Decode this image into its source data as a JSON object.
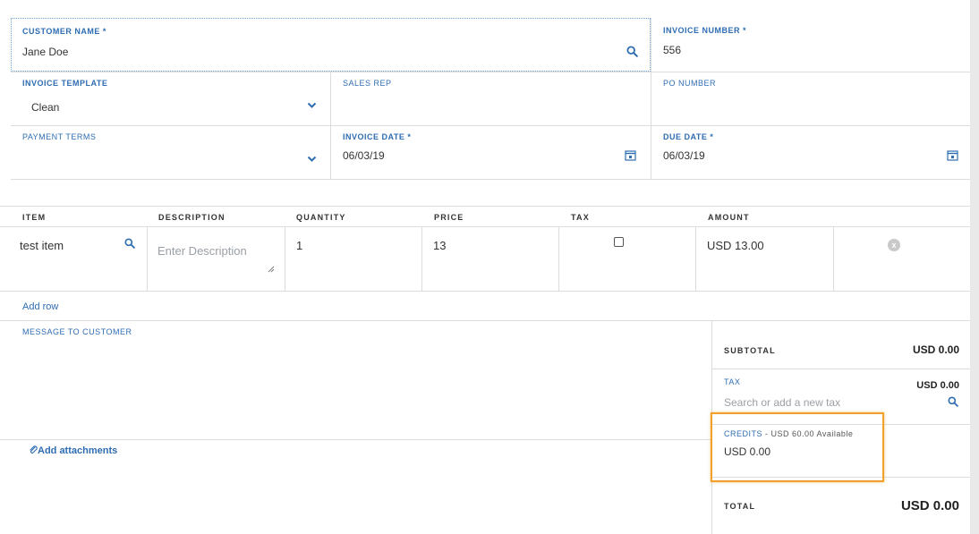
{
  "header": {
    "customer_name_label": "CUSTOMER NAME *",
    "customer_name_value": "Jane Doe",
    "invoice_number_label": "INVOICE NUMBER *",
    "invoice_number_value": "556"
  },
  "fields": {
    "invoice_template_label": "INVOICE TEMPLATE",
    "invoice_template_value": "Clean",
    "sales_rep_label": "SALES REP",
    "po_number_label": "PO NUMBER",
    "payment_terms_label": "PAYMENT TERMS",
    "invoice_date_label": "INVOICE DATE *",
    "invoice_date_value": "06/03/19",
    "due_date_label": "DUE DATE *",
    "due_date_value": "06/03/19"
  },
  "table": {
    "columns": [
      "ITEM",
      "DESCRIPTION",
      "QUANTITY",
      "PRICE",
      "TAX",
      "AMOUNT"
    ],
    "row": {
      "item": "test item",
      "description_placeholder": "Enter Description",
      "quantity": "1",
      "price": "13",
      "amount": "USD 13.00",
      "remove_label": "x"
    },
    "add_row_label": "Add row"
  },
  "message": {
    "label": "MESSAGE TO CUSTOMER",
    "attachments_label": "Add attachments"
  },
  "summary": {
    "subtotal_label": "SUBTOTAL",
    "subtotal_value": "USD 0.00",
    "tax_label": "TAX",
    "tax_value": "USD 0.00",
    "tax_placeholder": "Search or add a new tax",
    "credits_label": "CREDITS",
    "credits_available": " - USD 60.00 Available",
    "credits_value": "USD 0.00",
    "total_label": "TOTAL",
    "total_value": "USD 0.00"
  },
  "colors": {
    "accent": "#2f6db3",
    "highlight": "#f0a02c"
  },
  "icons": [
    "search-icon",
    "chevron-down-icon",
    "calendar-icon",
    "paperclip-icon",
    "remove-icon",
    "resize-grip-icon"
  ]
}
